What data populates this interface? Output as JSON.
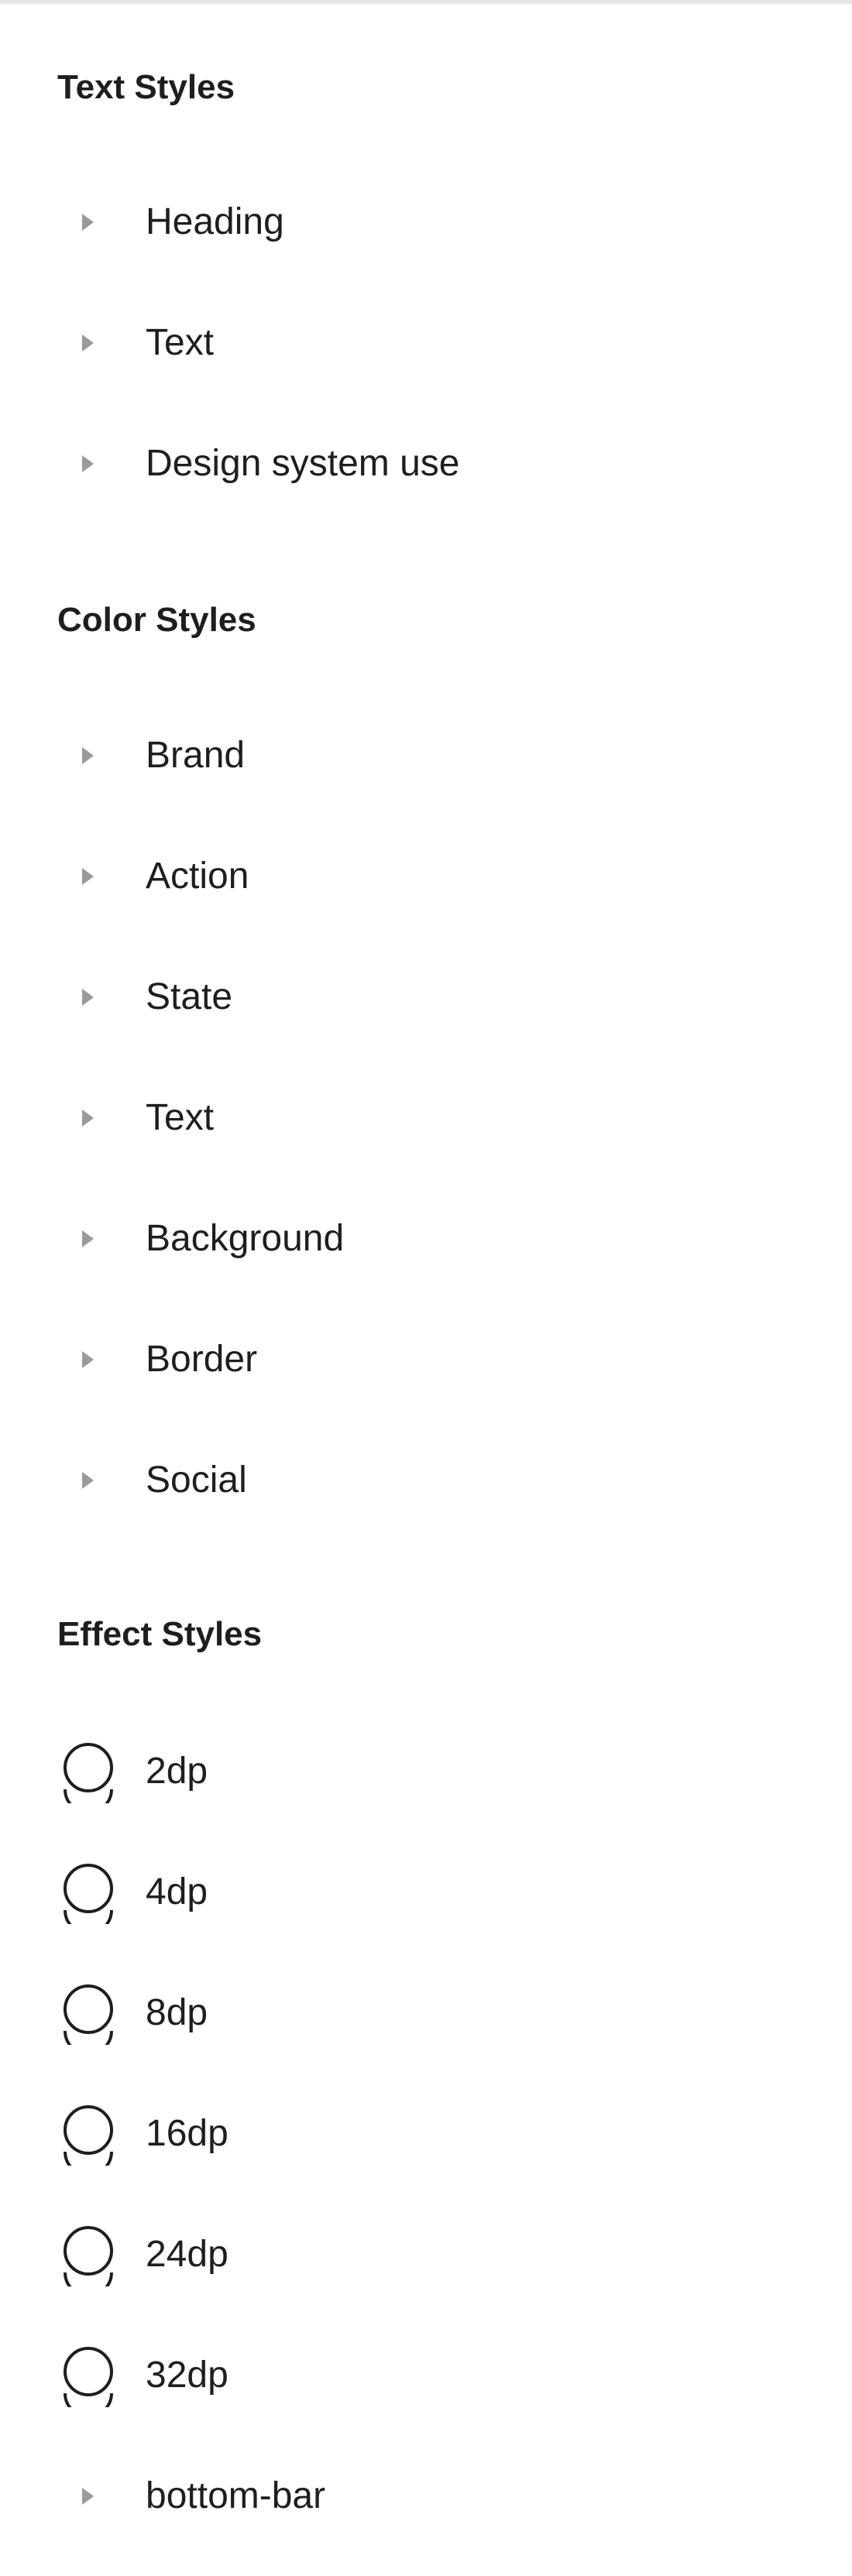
{
  "sections": {
    "text_styles": {
      "title": "Text Styles",
      "items": [
        {
          "label": "Heading"
        },
        {
          "label": "Text"
        },
        {
          "label": "Design system use"
        }
      ]
    },
    "color_styles": {
      "title": "Color Styles",
      "items": [
        {
          "label": "Brand"
        },
        {
          "label": "Action"
        },
        {
          "label": "State"
        },
        {
          "label": "Text"
        },
        {
          "label": "Background"
        },
        {
          "label": "Border"
        },
        {
          "label": "Social"
        }
      ]
    },
    "effect_styles": {
      "title": "Effect Styles",
      "items": [
        {
          "label": "2dp",
          "icon": "drop-shadow-effect-icon"
        },
        {
          "label": "4dp",
          "icon": "drop-shadow-effect-icon"
        },
        {
          "label": "8dp",
          "icon": "drop-shadow-effect-icon"
        },
        {
          "label": "16dp",
          "icon": "drop-shadow-effect-icon"
        },
        {
          "label": "24dp",
          "icon": "drop-shadow-effect-icon"
        },
        {
          "label": "32dp",
          "icon": "drop-shadow-effect-icon"
        }
      ],
      "groups": [
        {
          "label": "bottom-bar"
        }
      ]
    }
  },
  "colors": {
    "text": "#1e1e1e",
    "caret": "#9a9a9a",
    "divider": "#e6e6e6",
    "background": "#ffffff"
  }
}
